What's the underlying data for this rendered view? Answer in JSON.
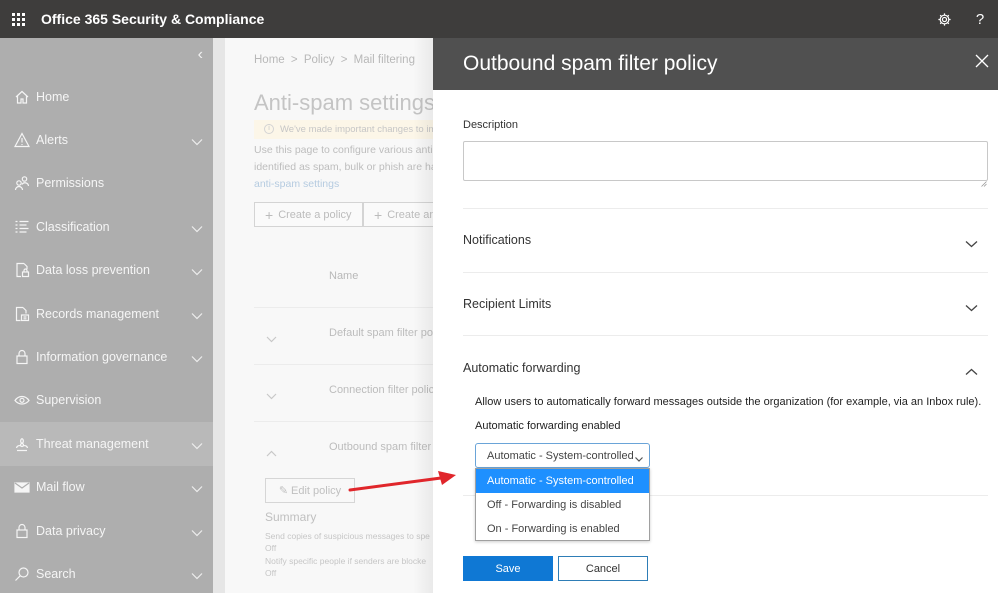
{
  "topbar": {
    "app_title": "Office 365 Security & Compliance",
    "icons": [
      "app-launcher-icon",
      "gear-icon",
      "help-icon"
    ],
    "help_glyph": "?"
  },
  "sidebar": {
    "collapse_glyph": "‹",
    "items": [
      {
        "label": "Home",
        "icon": "home-icon",
        "expandable": false
      },
      {
        "label": "Alerts",
        "icon": "warning-icon",
        "expandable": true
      },
      {
        "label": "Permissions",
        "icon": "people-icon",
        "expandable": false
      },
      {
        "label": "Classification",
        "icon": "list-icon",
        "expandable": true
      },
      {
        "label": "Data loss prevention",
        "icon": "lock-document-icon",
        "expandable": true
      },
      {
        "label": "Records management",
        "icon": "records-icon",
        "expandable": true
      },
      {
        "label": "Information governance",
        "icon": "lock-icon",
        "expandable": true
      },
      {
        "label": "Supervision",
        "icon": "eye-icon",
        "expandable": false
      },
      {
        "label": "Threat management",
        "icon": "biohazard-icon",
        "expandable": true,
        "active": true
      },
      {
        "label": "Mail flow",
        "icon": "mail-icon",
        "expandable": true
      },
      {
        "label": "Data privacy",
        "icon": "lock-icon",
        "expandable": true
      },
      {
        "label": "Search",
        "icon": "search-icon",
        "expandable": true
      }
    ]
  },
  "background_page": {
    "breadcrumb": [
      "Home",
      ">",
      "Policy",
      ">",
      "Mail filtering"
    ],
    "title": "Anti-spam settings",
    "notice": "We've made important changes to imp",
    "description_lines": [
      "Use this page to configure various anti",
      "identified as spam, bulk or phish are ha"
    ],
    "description_link": "anti-spam settings",
    "buttons": [
      {
        "label": "Create a policy",
        "icon": "plus-icon"
      },
      {
        "label": "Create an",
        "icon": "plus-icon"
      }
    ],
    "column_name": "Name",
    "rows": [
      {
        "name": "Default spam filter pol",
        "expanded": false
      },
      {
        "name": "Connection filter polic",
        "expanded": false
      },
      {
        "name": "Outbound spam filter",
        "expanded": true
      }
    ],
    "edit_button": "Edit policy",
    "summary_title": "Summary",
    "summary_lines": [
      "Send copies of suspicious messages to spe",
      "Off",
      "Notify specific people if senders are blocke",
      "Off"
    ]
  },
  "panel": {
    "title": "Outbound spam filter policy",
    "description_label": "Description",
    "description_value": "",
    "sections": [
      {
        "label": "Notifications",
        "expanded": false
      },
      {
        "label": "Recipient Limits",
        "expanded": false
      },
      {
        "label": "Automatic forwarding",
        "expanded": true
      }
    ],
    "forwarding": {
      "description": "Allow users to automatically forward messages outside the organization (for example, via an Inbox rule).",
      "field_label": "Automatic forwarding enabled",
      "selected": "Automatic - System-controlled",
      "options": [
        "Automatic - System-controlled",
        "Off - Forwarding is disabled",
        "On - Forwarding is enabled"
      ]
    },
    "save_label": "Save",
    "cancel_label": "Cancel"
  },
  "colors": {
    "topbar": "#3e3d3c",
    "panel_header": "#505050",
    "primary": "#0f78d4",
    "dropdown_highlight": "#1e90ff",
    "annotation_arrow": "#e0262b"
  }
}
